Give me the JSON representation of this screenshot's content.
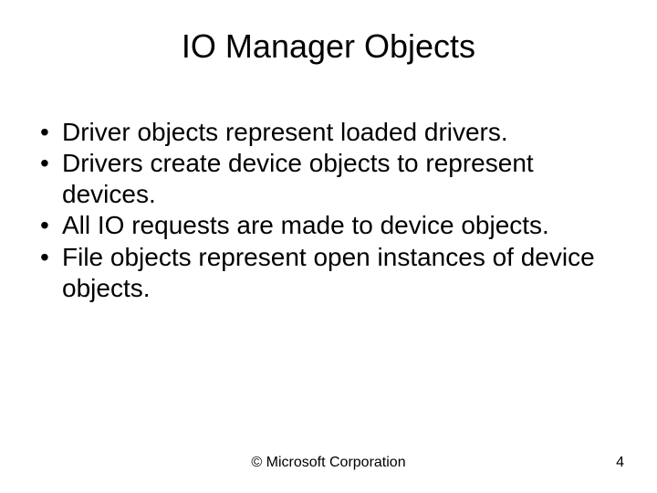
{
  "slide": {
    "title": "IO Manager Objects",
    "bullets": [
      "Driver objects represent loaded drivers.",
      "Drivers create device objects to represent devices.",
      "All IO requests are made to device objects.",
      "File objects represent open instances of device objects."
    ],
    "footer_center": "© Microsoft Corporation",
    "page_number": "4"
  }
}
